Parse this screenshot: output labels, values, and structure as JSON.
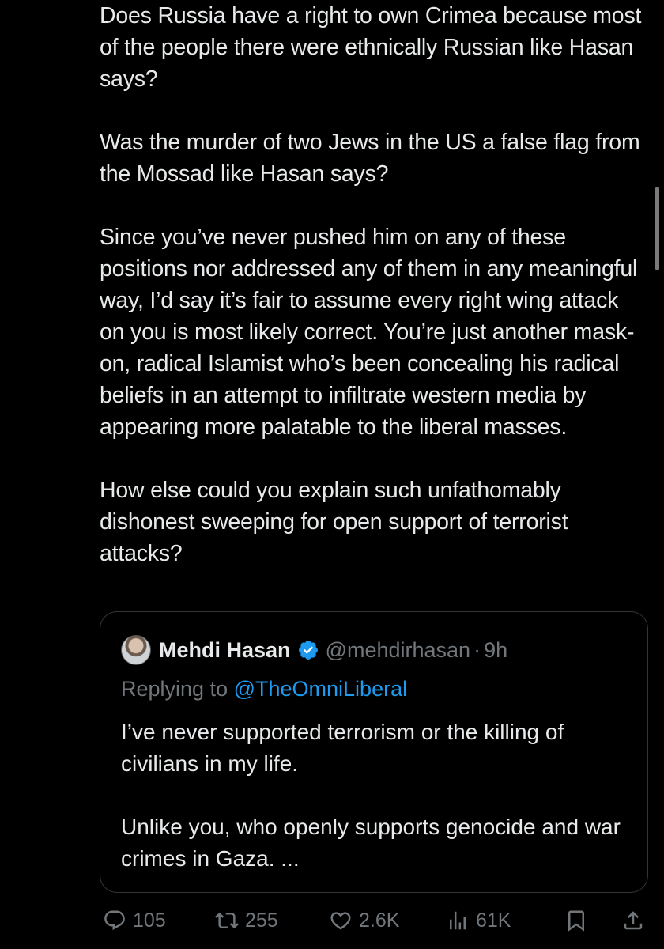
{
  "tweet": {
    "paragraphs": [
      "Does Russia have a right to own Crimea because most of the people there were ethnically Russian like Hasan says?",
      "Was the murder of two Jews in the US a false flag from the Mossad like Hasan says?",
      "Since you’ve never pushed him on any of these positions nor addressed any of them in any meaningful way, I’d say it’s fair to assume every right wing attack on you is most likely correct. You’re just another mask-on, radical Islamist who’s been concealing his radical beliefs in an attempt to infiltrate western media by appearing more palatable to the liberal masses.",
      "How else could you explain such unfathomably dishonest sweeping for open support of terrorist attacks?"
    ]
  },
  "quoted_tweet": {
    "author_name": "Mehdi Hasan",
    "author_handle": "@mehdirhasan",
    "separator": "·",
    "time": "9h",
    "replying_prefix": "Replying to ",
    "replying_to": "@TheOmniLiberal",
    "paragraphs": [
      "I’ve never supported terrorism or the killing of civilians in my life.",
      "Unlike you, who openly supports genocide and war crimes in Gaza. ..."
    ],
    "verified_color": "#1d9bf0"
  },
  "actions": {
    "replies": "105",
    "reposts": "255",
    "likes": "2.6K",
    "views": "61K"
  },
  "colors": {
    "background": "#000000",
    "text": "#e7e9ea",
    "muted": "#71767b",
    "accent": "#1d9bf0",
    "border": "#333639"
  },
  "icons": [
    "reply-icon",
    "repost-icon",
    "like-icon",
    "views-icon",
    "bookmark-icon",
    "share-icon",
    "verified-badge-icon"
  ]
}
